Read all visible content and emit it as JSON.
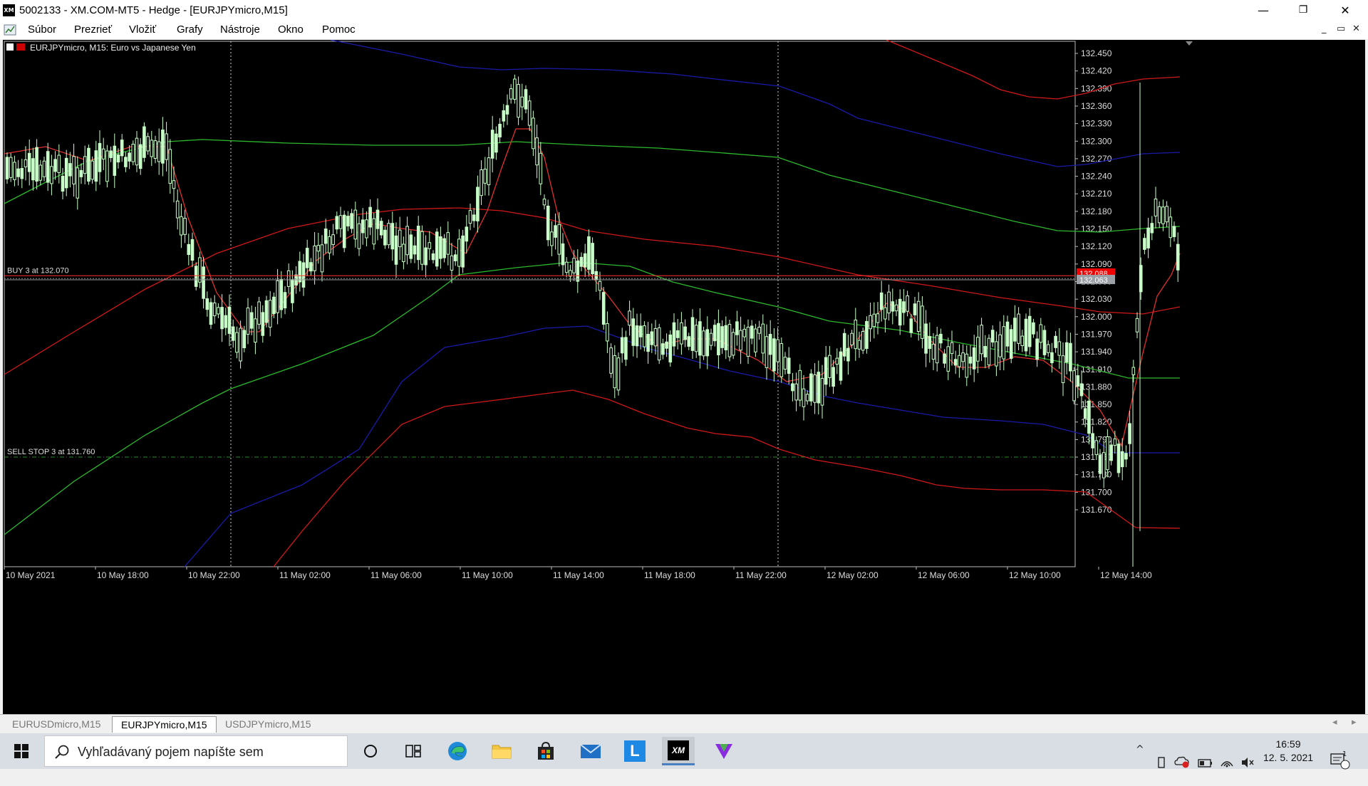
{
  "window": {
    "title": "5002133 - XM.COM-MT5 - Hedge - [EURJPYmicro,M15]",
    "logo": "XM",
    "controls": {
      "minimize": "—",
      "restore": "❐",
      "close": "✕"
    }
  },
  "menu": {
    "items": [
      "Súbor",
      "Prezrieť",
      "Vložiť",
      "Grafy",
      "Nástroje",
      "Okno",
      "Pomoc"
    ],
    "mdi": {
      "minimize": "_",
      "restore": "▭",
      "close": "✕"
    }
  },
  "chart": {
    "header": "EURJPYmicro, M15:  Euro vs Japanese Yen",
    "price_labels": [
      "132.450",
      "132.420",
      "132.390",
      "132.360",
      "132.330",
      "132.300",
      "132.270",
      "132.240",
      "132.210",
      "132.180",
      "132.150",
      "132.120",
      "132.090",
      "132.060",
      "132.030",
      "132.000",
      "131.970",
      "131.940",
      "131.910",
      "131.880",
      "131.850",
      "131.820",
      "131.790",
      "131.760",
      "131.730",
      "131.700",
      "131.670"
    ],
    "time_labels": [
      "10 May 2021",
      "10 May 18:00",
      "10 May 22:00",
      "11 May 02:00",
      "11 May 06:00",
      "11 May 10:00",
      "11 May 14:00",
      "11 May 18:00",
      "11 May 22:00",
      "12 May 02:00",
      "12 May 06:00",
      "12 May 10:00",
      "12 May 14:00"
    ],
    "orders": [
      {
        "label": "BUY 3 at 132.070",
        "price": 132.07,
        "color": "#ff3030"
      },
      {
        "label": "SELL STOP 3 at 131.760",
        "price": 131.76,
        "color": "#2a8a2a"
      }
    ],
    "current_price": {
      "label": "132.063",
      "value": 132.063
    },
    "buy_marker": {
      "label": "132.088",
      "value": 132.074
    },
    "colors": {
      "background": "#000000",
      "candle": "#c8ffc8",
      "red_band": "#d01818",
      "blue_band": "#1a1aa8",
      "green_band": "#2cb82c"
    }
  },
  "tabs": {
    "items": [
      {
        "label": "EURUSDmicro,M15",
        "active": false
      },
      {
        "label": "EURJPYmicro,M15",
        "active": true
      },
      {
        "label": "USDJPYmicro,M15",
        "active": false
      }
    ]
  },
  "taskbar": {
    "search_placeholder": "Vyhľadávaný pojem napíšte sem",
    "apps": [
      "cortana-icon",
      "task-view-icon",
      "edge-icon",
      "file-explorer-icon",
      "store-icon",
      "mail-icon",
      "l-app-icon",
      "xm-app-icon",
      "v-app-icon"
    ],
    "l_app_label": "L",
    "xm_app_label": "XM",
    "time": "16:59",
    "date": "12. 5. 2021",
    "notification_count": "1"
  }
}
